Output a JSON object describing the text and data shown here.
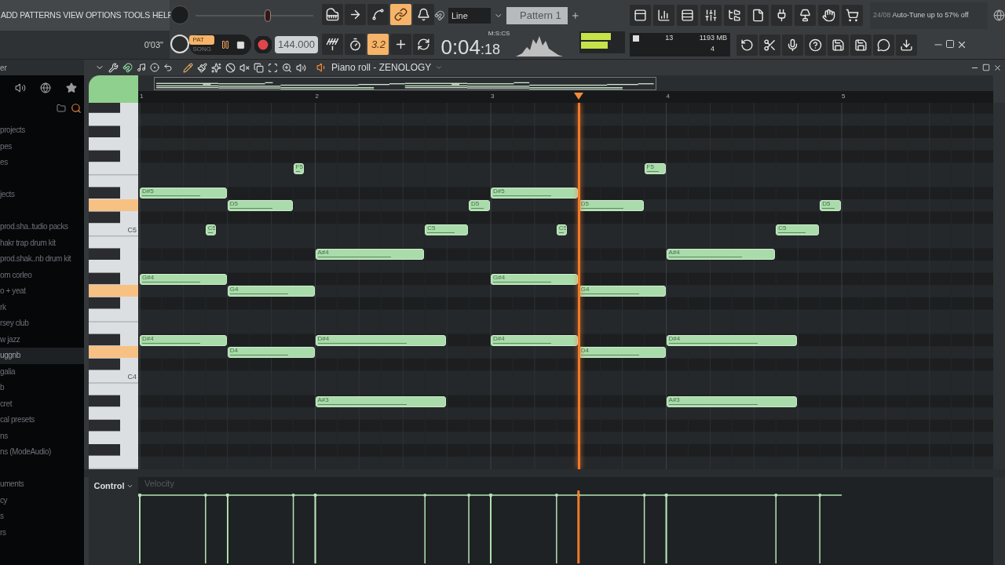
{
  "menu": [
    "ADD",
    "PATTERNS",
    "VIEW",
    "OPTIONS",
    "TOOLS",
    "HELP"
  ],
  "song_time": "0'03\"",
  "pitch_slider": {
    "level": 0.62
  },
  "modes": [
    {
      "label": "PAT",
      "selected": true
    },
    {
      "label": "SONG",
      "selected": false
    }
  ],
  "tempo": "144.000",
  "tools_top": [
    {
      "kind": "keyboard",
      "on": false
    },
    {
      "kind": "arrow",
      "on": false
    },
    {
      "kind": "curve",
      "on": false
    },
    {
      "kind": "link",
      "on": true
    },
    {
      "kind": "bell",
      "on": false
    }
  ],
  "tools_bottom": [
    {
      "kind": "antenna",
      "on": false
    },
    {
      "kind": "timer",
      "on": false
    },
    {
      "kind": "text",
      "label": "3.2",
      "on": true
    },
    {
      "kind": "plus",
      "on": false
    },
    {
      "kind": "loop",
      "on": false
    }
  ],
  "snap": "Line",
  "pattern": "Pattern 1",
  "views": [
    {
      "kind": "playlist",
      "on": false
    },
    {
      "kind": "chart",
      "on": false
    },
    {
      "kind": "rows",
      "on": false
    },
    {
      "kind": "sliders",
      "on": false
    },
    {
      "kind": "tree",
      "on": false
    },
    {
      "kind": "file",
      "on": false
    },
    {
      "kind": "plug",
      "on": false
    },
    {
      "kind": "lamp",
      "on": false
    },
    {
      "kind": "hand",
      "on": false
    },
    {
      "kind": "cart",
      "on": false
    }
  ],
  "news": {
    "date": "24/08",
    "text": "Auto-Tune up to 57% off"
  },
  "time": {
    "unit": "M:S:CS",
    "main": "0:04",
    "sub": ":18"
  },
  "cpu": {
    "polyphony": "13",
    "memory": "1193 MB",
    "voices": "4"
  },
  "actions": [
    {
      "kind": "undo"
    },
    {
      "kind": "scissors"
    },
    {
      "kind": "mic"
    },
    {
      "kind": "help"
    },
    {
      "kind": "save"
    },
    {
      "kind": "save"
    },
    {
      "kind": "chat"
    },
    {
      "kind": "download"
    }
  ],
  "browser": {
    "title": "er",
    "sections": [
      [
        {
          "label": "projects",
          "selected": false
        },
        {
          "label": "pes",
          "selected": false
        },
        {
          "label": "es",
          "selected": false
        }
      ],
      [
        {
          "label": "jects",
          "selected": false
        }
      ],
      [
        {
          "label": "prod.sha..tudio packs",
          "selected": false
        },
        {
          "label": "hakr trap drum kit",
          "selected": false
        },
        {
          "label": "prod.shak..nb drum kit",
          "selected": false
        },
        {
          "label": "om corleo",
          "selected": false
        },
        {
          "label": "o + yeat",
          "selected": false
        },
        {
          "label": "rk",
          "selected": false
        },
        {
          "label": "rsey club",
          "selected": false
        },
        {
          "label": "w jazz",
          "selected": false
        },
        {
          "label": "uggnb",
          "selected": true
        },
        {
          "label": "galia",
          "selected": false
        },
        {
          "label": "b",
          "selected": false
        },
        {
          "label": "cret",
          "selected": false
        },
        {
          "label": "cal presets",
          "selected": false
        },
        {
          "label": "ns",
          "selected": false
        },
        {
          "label": "ns (ModeAudio)",
          "selected": false
        }
      ],
      [
        {
          "label": "uments",
          "selected": false
        },
        {
          "label": "cy",
          "selected": false
        },
        {
          "label": "s",
          "selected": false
        },
        {
          "label": "rs",
          "selected": false
        }
      ]
    ]
  },
  "piano_roll": {
    "title": "Piano roll - ZENOLOGY",
    "bars": [
      "1",
      "2",
      "3",
      "4",
      "5"
    ],
    "key_labels": [
      "C5",
      "C4"
    ],
    "notes": [
      {
        "label": "D#5",
        "playing": false
      },
      {
        "label": "C5",
        "playing": false
      },
      {
        "label": "D5",
        "playing": false
      },
      {
        "label": "F5",
        "playing": false
      },
      {
        "label": "A#4",
        "playing": false
      },
      {
        "label": "C5",
        "playing": false
      },
      {
        "label": "D5",
        "playing": false
      },
      {
        "label": "G#4",
        "playing": false
      },
      {
        "label": "G4",
        "playing": false
      },
      {
        "label": "D#4",
        "playing": false
      },
      {
        "label": "D4",
        "playing": false
      },
      {
        "label": "D#4",
        "playing": false
      },
      {
        "label": "A#3",
        "playing": false
      },
      {
        "label": "D#5",
        "playing": false
      },
      {
        "label": "C5",
        "playing": false
      },
      {
        "label": "D5",
        "playing": true
      },
      {
        "label": "F5",
        "playing": false
      },
      {
        "label": "A#4",
        "playing": false
      },
      {
        "label": "C5",
        "playing": false
      },
      {
        "label": "D5",
        "playing": false
      },
      {
        "label": "G#4",
        "playing": false
      },
      {
        "label": "G4",
        "playing": true
      },
      {
        "label": "D#4",
        "playing": false
      },
      {
        "label": "D4",
        "playing": true
      },
      {
        "label": "D#4",
        "playing": false
      },
      {
        "label": "A#3",
        "playing": false
      }
    ],
    "control": {
      "label": "Control",
      "parameter": "Velocity"
    }
  }
}
